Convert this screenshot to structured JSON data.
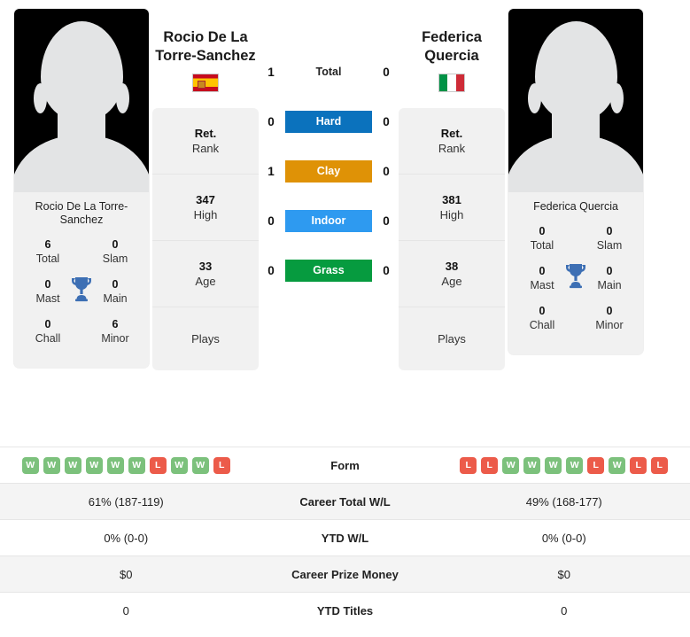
{
  "players": {
    "left": {
      "name": "Rocio De La Torre-Sanchez",
      "name_line1": "Rocio De La",
      "name_line2": "Torre-Sanchez",
      "photo_caption": "Rocio De La Torre-Sanchez",
      "flag": "spain-flag",
      "trophies": [
        {
          "num": "6",
          "label": "Total"
        },
        {
          "num": "0",
          "label": "Slam"
        },
        {
          "num": "0",
          "label": "Mast"
        },
        {
          "num": "0",
          "label": "Main"
        },
        {
          "num": "0",
          "label": "Chall"
        },
        {
          "num": "6",
          "label": "Minor"
        }
      ],
      "info": [
        {
          "value": "Ret.",
          "label": "Rank"
        },
        {
          "value": "347",
          "label": "High"
        },
        {
          "value": "33",
          "label": "Age"
        },
        {
          "value": "",
          "label": "Plays"
        }
      ],
      "form": [
        "W",
        "W",
        "W",
        "W",
        "W",
        "W",
        "L",
        "W",
        "W",
        "L"
      ],
      "career_total_wl": "61% (187-119)",
      "ytd_wl": "0% (0-0)",
      "career_prize_money": "$0",
      "ytd_titles": "0"
    },
    "right": {
      "name": "Federica Quercia",
      "name_line1": "Federica",
      "name_line2": "Quercia",
      "photo_caption": "Federica Quercia",
      "flag": "italy-flag",
      "trophies": [
        {
          "num": "0",
          "label": "Total"
        },
        {
          "num": "0",
          "label": "Slam"
        },
        {
          "num": "0",
          "label": "Mast"
        },
        {
          "num": "0",
          "label": "Main"
        },
        {
          "num": "0",
          "label": "Chall"
        },
        {
          "num": "0",
          "label": "Minor"
        }
      ],
      "info": [
        {
          "value": "Ret.",
          "label": "Rank"
        },
        {
          "value": "381",
          "label": "High"
        },
        {
          "value": "38",
          "label": "Age"
        },
        {
          "value": "",
          "label": "Plays"
        }
      ],
      "form": [
        "L",
        "L",
        "W",
        "W",
        "W",
        "W",
        "L",
        "W",
        "L",
        "L"
      ],
      "career_total_wl": "49% (168-177)",
      "ytd_wl": "0% (0-0)",
      "career_prize_money": "$0",
      "ytd_titles": "0"
    }
  },
  "surfaces": [
    {
      "label": "Total",
      "left": "1",
      "right": "0",
      "color": "transparent"
    },
    {
      "label": "Hard",
      "left": "0",
      "right": "0",
      "color": "#0b72bd"
    },
    {
      "label": "Clay",
      "left": "1",
      "right": "0",
      "color": "#df9206"
    },
    {
      "label": "Indoor",
      "left": "0",
      "right": "0",
      "color": "#2e9af0"
    },
    {
      "label": "Grass",
      "left": "0",
      "right": "0",
      "color": "#069b3f"
    }
  ],
  "table_rows": [
    {
      "label": "Form"
    },
    {
      "label": "Career Total W/L",
      "left": "61% (187-119)",
      "right": "49% (168-177)"
    },
    {
      "label": "YTD W/L",
      "left": "0% (0-0)",
      "right": "0% (0-0)"
    },
    {
      "label": "Career Prize Money",
      "left": "$0",
      "right": "$0"
    },
    {
      "label": "YTD Titles",
      "left": "0",
      "right": "0"
    }
  ]
}
